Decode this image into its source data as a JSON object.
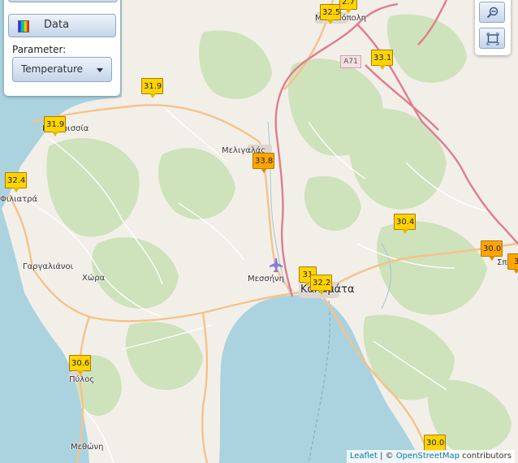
{
  "panel": {
    "data_button_label": "Data",
    "parameter_label": "Parameter:",
    "parameter_value": "Temperature"
  },
  "road_label": "A71",
  "places": {
    "megalopoli": "Μεγαλόπολη",
    "kyparissia": "Κυπαρισσία",
    "filiatra": "Φιλιατρά",
    "meligalas": "Μελιγαλάς",
    "gargalianoi": "Γαργαλιάνοι",
    "chora": "Χώρα",
    "messini": "Μεσσήνη",
    "kalamata": "Καλαμάτα",
    "pylos": "Πύλος",
    "methoni": "Μεθώνη",
    "sparti_partial": "Σπ"
  },
  "markers": {
    "m1": "32.5",
    "m2": "2.7",
    "m3": "33.1",
    "m4": "31.9",
    "m5": "31.9",
    "m6": "32.4",
    "m7": "33.8",
    "m8": "30.4",
    "m9": "30.0",
    "m10": "31",
    "m11": "32.2",
    "m12": "30.6",
    "m13": "30.0",
    "m14": "3"
  },
  "attribution": {
    "leaflet": "Leaflet",
    "separator": " | © ",
    "osm": "OpenStreetMap",
    "contributors": " contributors"
  },
  "colors": {
    "sea": "#aad3df",
    "land": "#f2efe9",
    "forest": "#c8e0b4",
    "motorway": "#e07c8c",
    "primary_road": "#f5c28a",
    "marker_yellow": "#ffd400",
    "marker_orange": "#ffa500"
  }
}
